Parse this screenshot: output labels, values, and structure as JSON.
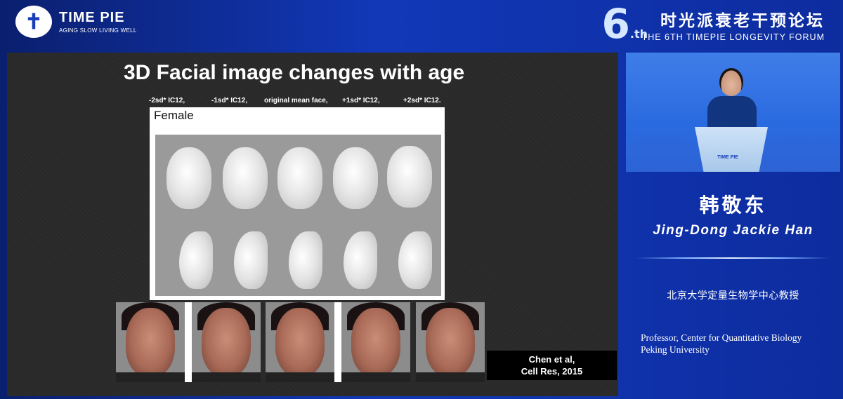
{
  "header": {
    "logo": {
      "mark": "✝",
      "title": "TIME PIE",
      "subtitle": "AGING SLOW LIVING WELL"
    },
    "forum": {
      "number": "6",
      "suffix": ".th",
      "title_cn": "时光派衰老干预论坛",
      "title_en": "THE 6TH TIMEPIE LONGEVITY FORUM"
    }
  },
  "slide": {
    "title": "3D Facial image changes with age",
    "column_labels": [
      "-2sd* IC12,",
      "-1sd* IC12,",
      "original mean face,",
      "+1sd* IC12,",
      "+2sd* IC12."
    ],
    "panel_label": "Female",
    "citation_line1": "Chen et al,",
    "citation_line2": "Cell Res, 2015"
  },
  "speaker": {
    "name_cn": "韩敬东",
    "name_en": "Jing-Dong Jackie Han",
    "title_cn": "北京大学定量生物学中心教授",
    "title_en_line1": "Professor, Center for Quantitative Biology",
    "title_en_line2": "Peking University",
    "podium_text": "TIME PIE"
  }
}
